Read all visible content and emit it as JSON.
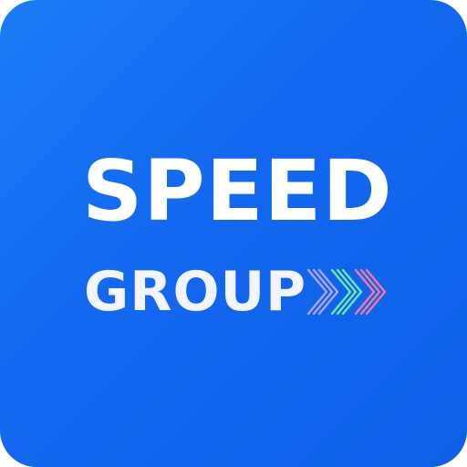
{
  "logo": {
    "title": "SPEED",
    "subtitle": "GROUP",
    "chevron_icon": "triple-chevron-right-icon"
  },
  "colors": {
    "background": "#1268ef",
    "text": "#ffffff",
    "chevron_1": "#b9a6ff",
    "chevron_2": "#6ff0a0",
    "chevron_3": "#ff7b9a"
  }
}
